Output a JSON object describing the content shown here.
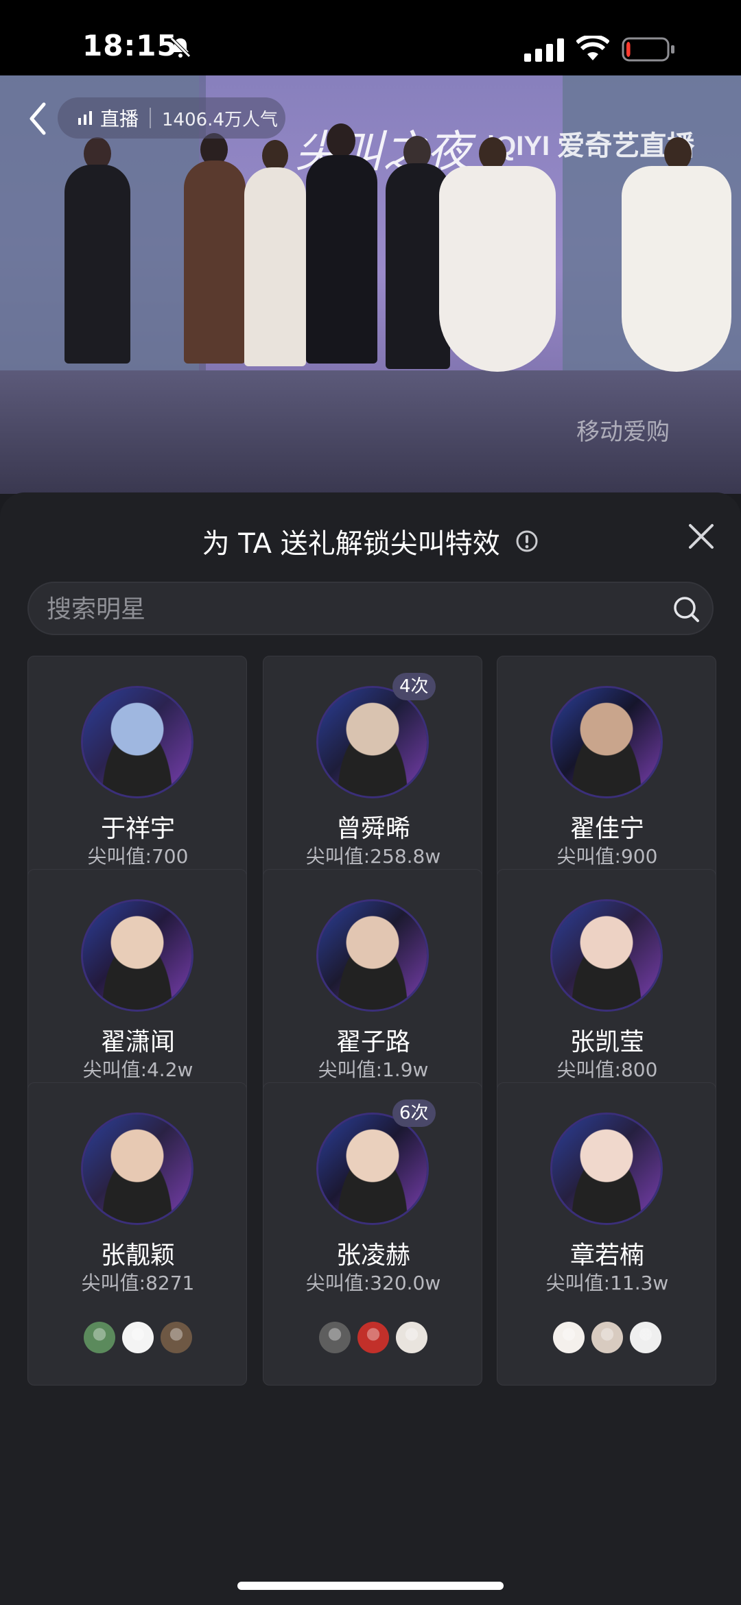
{
  "status_bar": {
    "time": "18:15",
    "battery_level": 0.1,
    "battery_color": "#ff3b30"
  },
  "video": {
    "live_label": "直播",
    "viewers": "1406.4万人气",
    "stage_title": "尖叫之夜",
    "stage_brand": "iQIYI 爱奇艺直播",
    "watermark": "移动爱购"
  },
  "sheet": {
    "title": "为 TA 送礼解锁尖叫特效",
    "search": {
      "placeholder": "搜索明星",
      "value": ""
    },
    "accent": "#3b2f7a",
    "stars": [
      {
        "name": "于祥宇",
        "score": "尖叫值:700",
        "badge": "",
        "avatar_colors": [
          "#9fb7e0",
          "#2b2350"
        ],
        "fans": [
          {
            "color": "#6ab0f0",
            "online": true
          },
          {
            "color": "#7ab8f4",
            "online": true
          },
          {
            "color": "#2a2a2a",
            "online": false
          }
        ]
      },
      {
        "name": "曾舜晞",
        "score": "尖叫值:258.8w",
        "badge": "4次",
        "avatar_colors": [
          "#d9c3b0",
          "#1d1d3a"
        ],
        "fans": [
          {
            "color": "#e9e4de",
            "online": false
          },
          {
            "color": "#b8a9a0",
            "online": false
          },
          {
            "color": "#3a6070",
            "online": true
          }
        ]
      },
      {
        "name": "翟佳宁",
        "score": "尖叫值:900",
        "badge": "",
        "avatar_colors": [
          "#c9a58c",
          "#15152b"
        ],
        "fans": [
          {
            "color": "#5a4c7a",
            "online": false
          },
          {
            "color": "#7ab8f4",
            "online": false
          },
          {
            "color": "#2a3c6a",
            "online": false
          }
        ]
      },
      {
        "name": "翟潇闻",
        "score": "尖叫值:4.2w",
        "badge": "",
        "avatar_colors": [
          "#e8cdb8",
          "#231a3d"
        ],
        "fans": [
          {
            "color": "#8aa2b8",
            "online": false
          },
          {
            "color": "#d6b97a",
            "online": false
          },
          {
            "color": "#2a2a2a",
            "online": false
          }
        ]
      },
      {
        "name": "翟子路",
        "score": "尖叫值:1.9w",
        "badge": "",
        "avatar_colors": [
          "#e2c6b2",
          "#1c1a30"
        ],
        "fans": [
          {
            "color": "#f2ece6",
            "online": false
          },
          {
            "color": "#7ab8f4",
            "online": false
          },
          {
            "color": "#f4c7d6",
            "online": false
          }
        ]
      },
      {
        "name": "张凯莹",
        "score": "尖叫值:800",
        "badge": "",
        "avatar_colors": [
          "#edd2c4",
          "#2a1f40"
        ],
        "fans": [
          {
            "color": "#7ea0a8",
            "online": false
          },
          {
            "color": "#2f3a44",
            "online": true
          },
          {
            "color": "#4b4f3c",
            "online": true
          }
        ]
      },
      {
        "name": "张靓颖",
        "score": "尖叫值:8271",
        "badge": "",
        "avatar_colors": [
          "#e7c9b3",
          "#2a2244"
        ],
        "fans": [
          {
            "color": "#5b8a5c",
            "online": false
          },
          {
            "color": "#f4f4f4",
            "online": false
          },
          {
            "color": "#6e5844",
            "online": false
          }
        ]
      },
      {
        "name": "张凌赫",
        "score": "尖叫值:320.0w",
        "badge": "6次",
        "avatar_colors": [
          "#ead0bd",
          "#1b1832"
        ],
        "fans": [
          {
            "color": "#5e5e5e",
            "online": false
          },
          {
            "color": "#c2302a",
            "online": false
          },
          {
            "color": "#e9e4de",
            "online": false
          }
        ]
      },
      {
        "name": "章若楠",
        "score": "尖叫值:11.3w",
        "badge": "",
        "avatar_colors": [
          "#f0d8cc",
          "#262040"
        ],
        "fans": [
          {
            "color": "#f4f0ec",
            "online": false
          },
          {
            "color": "#d8cbc0",
            "online": false
          },
          {
            "color": "#efefef",
            "online": false
          }
        ]
      }
    ]
  }
}
